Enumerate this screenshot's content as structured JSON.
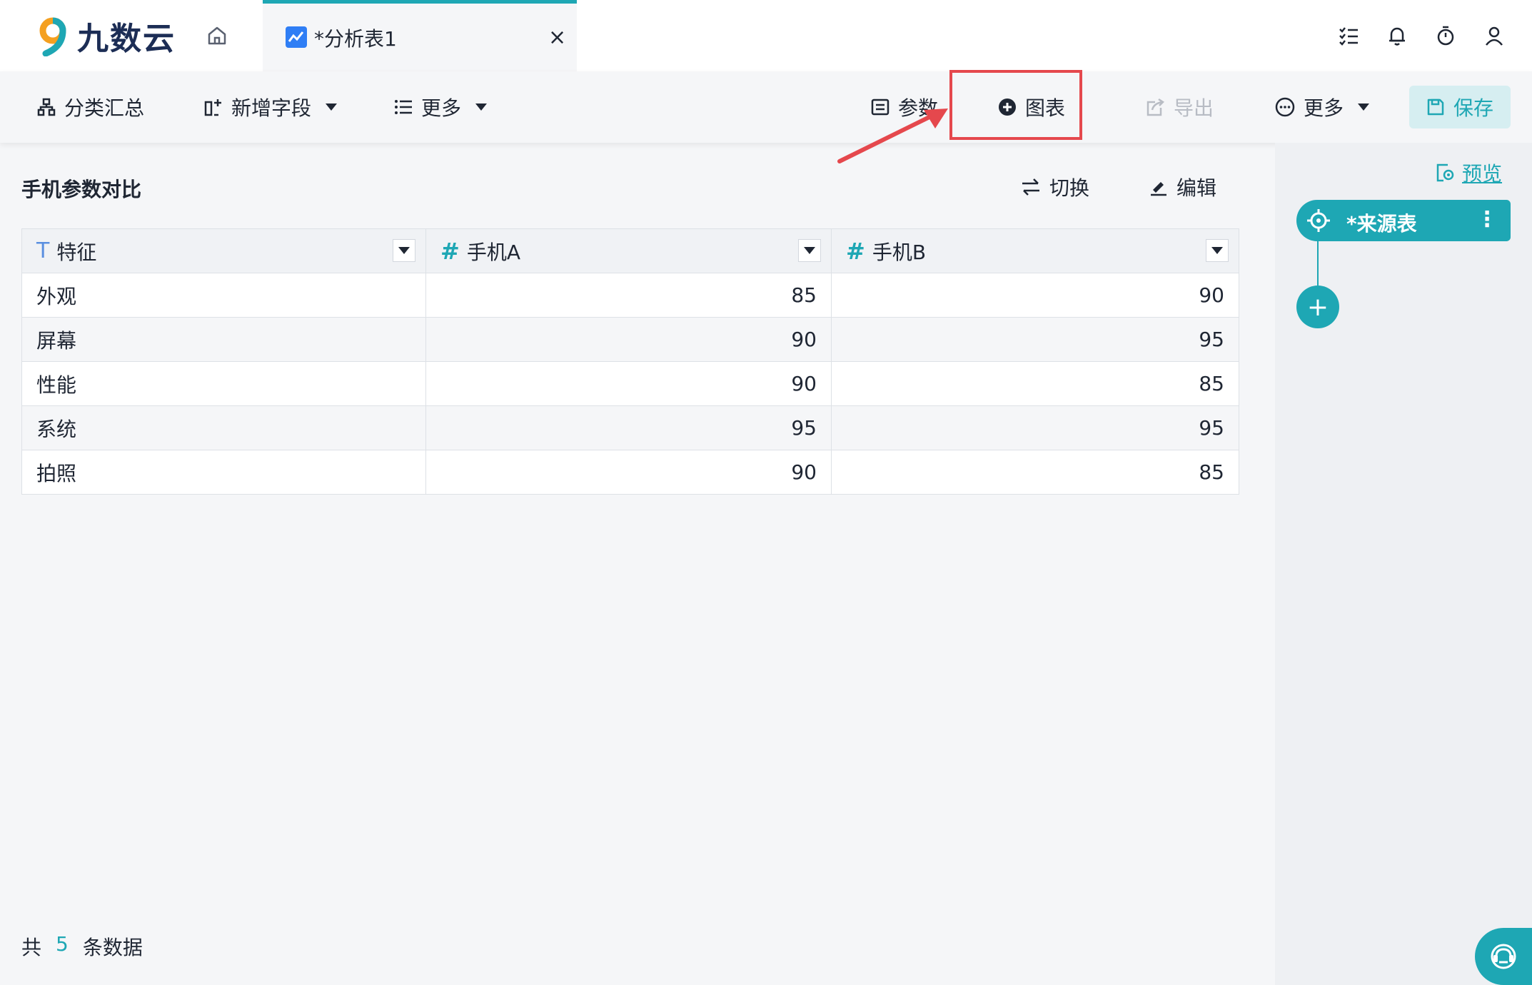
{
  "app": {
    "logo_text": "九数云"
  },
  "tabs": {
    "active_title": "*分析表1",
    "close_glyph": "×"
  },
  "toolbar": {
    "classify_summary": "分类汇总",
    "add_field": "新增字段",
    "more_left": "更多",
    "params": "参数",
    "chart": "图表",
    "export": "导出",
    "more_right": "更多",
    "save": "保存"
  },
  "panel": {
    "title": "手机参数对比",
    "switch": "切换",
    "edit": "编辑"
  },
  "table": {
    "columns": [
      {
        "type_glyph": "T",
        "label": "特征"
      },
      {
        "type_glyph": "#",
        "label": "手机A"
      },
      {
        "type_glyph": "#",
        "label": "手机B"
      }
    ],
    "rows": [
      [
        "外观",
        "85",
        "90"
      ],
      [
        "屏幕",
        "90",
        "95"
      ],
      [
        "性能",
        "90",
        "85"
      ],
      [
        "系统",
        "95",
        "95"
      ],
      [
        "拍照",
        "90",
        "85"
      ]
    ]
  },
  "footer": {
    "prefix": "共",
    "count": "5",
    "suffix": "条数据"
  },
  "right_panel": {
    "preview": "预览",
    "source_node": "*来源表",
    "add_glyph": "+",
    "dots": "⋮"
  },
  "colors": {
    "accent": "#1ea7b4",
    "highlight": "#e5484d",
    "tab_icon": "#2f7ef5"
  }
}
